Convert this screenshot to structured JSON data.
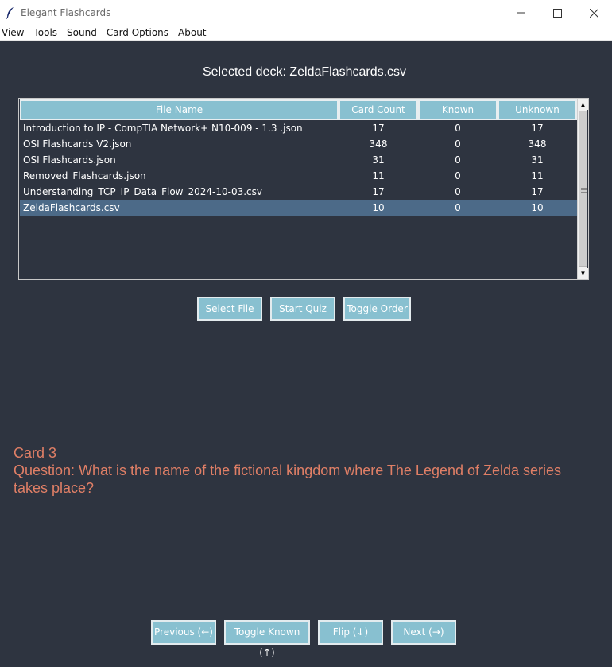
{
  "window": {
    "title": "Elegant Flashcards",
    "icon": "feather-icon"
  },
  "menu": {
    "items": [
      "View",
      "Tools",
      "Sound",
      "Card Options",
      "About"
    ]
  },
  "deck": {
    "label": "Selected deck: ZeldaFlashcards.csv"
  },
  "table": {
    "columns": [
      "File Name",
      "Card Count",
      "Known",
      "Unknown"
    ],
    "rows": [
      {
        "name": "Introduction to IP - CompTIA Network+ N10-009 - 1.3 .json",
        "count": "17",
        "known": "0",
        "unknown": "17",
        "selected": false
      },
      {
        "name": "OSI Flashcards V2.json",
        "count": "348",
        "known": "0",
        "unknown": "348",
        "selected": false
      },
      {
        "name": "OSI Flashcards.json",
        "count": "31",
        "known": "0",
        "unknown": "31",
        "selected": false
      },
      {
        "name": "Removed_Flashcards.json",
        "count": "11",
        "known": "0",
        "unknown": "11",
        "selected": false
      },
      {
        "name": "Understanding_TCP_IP_Data_Flow_2024-10-03.csv",
        "count": "17",
        "known": "0",
        "unknown": "17",
        "selected": false
      },
      {
        "name": "ZeldaFlashcards.csv",
        "count": "10",
        "known": "0",
        "unknown": "10",
        "selected": true
      }
    ]
  },
  "file_buttons": {
    "select_file": "Select File",
    "start_quiz": "Start Quiz",
    "toggle_order": "Toggle Order"
  },
  "card": {
    "number": "Card 3",
    "question": "Question: What is the name of the fictional kingdom where The Legend of Zelda series takes place?"
  },
  "nav_buttons": {
    "previous": "Previous (←)",
    "toggle_known": "Toggle Known (↑)",
    "flip": "Flip (↓)",
    "next": "Next (→)"
  },
  "colors": {
    "background": "#2e3440",
    "accent": "#88c0d0",
    "selected_row": "#4c6a88",
    "card_text": "#e07f66"
  }
}
